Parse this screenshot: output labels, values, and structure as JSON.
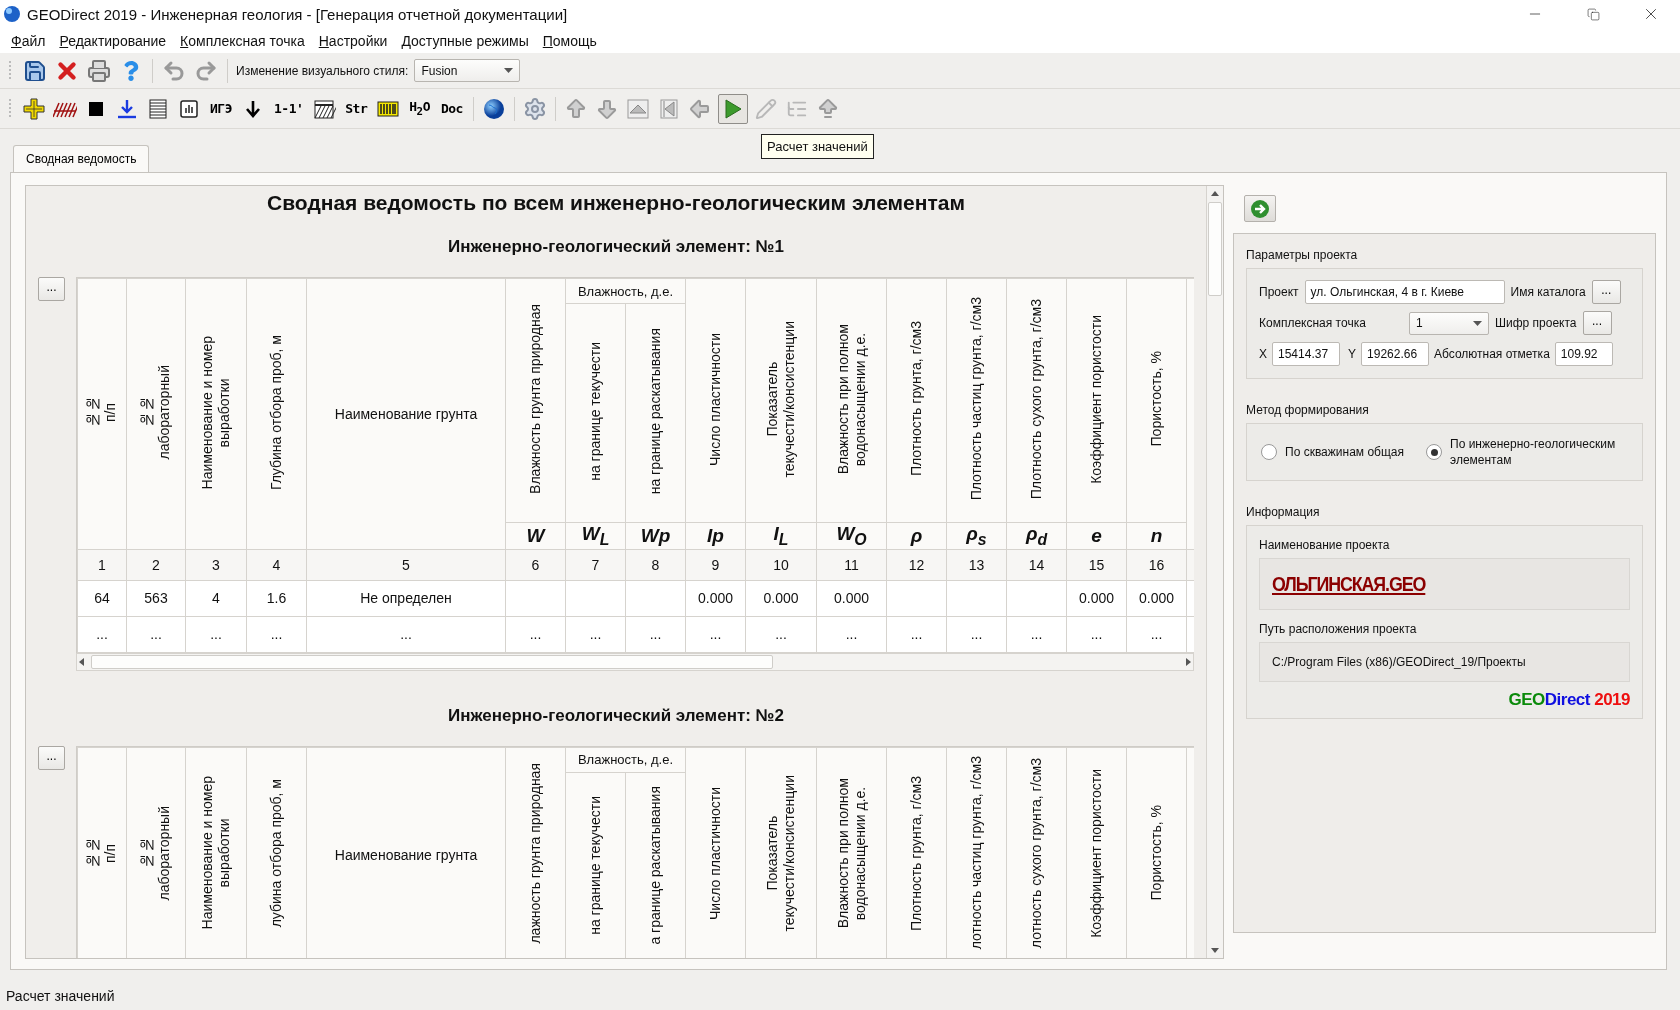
{
  "window": {
    "title": "GEODirect 2019 - Инженерная геология - [Генерация отчетной документации]"
  },
  "menu": [
    "Файл",
    "Редактирование",
    "Комплексная точка",
    "Настройки",
    "Доступные режимы",
    "Помощь"
  ],
  "style_combo": {
    "label": "Изменение визуального стиля:",
    "value": "Fusion"
  },
  "toolbar_text_buttons": [
    "ИГЭ",
    "1-1'",
    "Str",
    "H$_{2}$O",
    "Doc"
  ],
  "run_button": {
    "hovered": true
  },
  "tooltip": "Расчет значений",
  "tabs": [
    {
      "label": "Сводная ведомость",
      "selected": true
    }
  ],
  "report": {
    "title": "Сводная ведомость по всем инженерно-геологическим элементам",
    "sections": [
      {
        "heading": "Инженерно-геологический элемент:  №1",
        "more_button": "...",
        "column_group": "Влажность, д.е.",
        "columns": [
          {
            "kind": "vertical",
            "label": "№№\nп/п"
          },
          {
            "kind": "vertical",
            "label": "№№\nлабораторный"
          },
          {
            "kind": "vertical",
            "label": "Наименование и номер\nвыработки"
          },
          {
            "kind": "vertical",
            "label": "Глубина отбора проб, м"
          },
          {
            "kind": "horizontal",
            "label": "Наименование грунта"
          },
          {
            "kind": "vertical",
            "label": "Влажность грунта природная",
            "symbol": "W"
          },
          {
            "kind": "vertical",
            "in_group": true,
            "label": "на границе текучести",
            "symbol": "W$_{L}$"
          },
          {
            "kind": "vertical",
            "in_group": true,
            "label": "на границе раскатывания",
            "symbol": "Wp"
          },
          {
            "kind": "vertical",
            "label": "Число пластичности",
            "symbol": "Ip"
          },
          {
            "kind": "vertical",
            "label": "Показатель\nтекучести/консистенции",
            "symbol": "I$_{L}$"
          },
          {
            "kind": "vertical",
            "label": "Влажность при полном\nводонасыщении д.е.",
            "symbol": "W$_{O}$"
          },
          {
            "kind": "vertical",
            "label": "Плотность грунта, г/см3",
            "symbol": "ρ"
          },
          {
            "kind": "vertical",
            "label": "Плотность частиц грунта, г/см3",
            "symbol": "ρ$_{s}$"
          },
          {
            "kind": "vertical",
            "label": "Плотность сухого грунта, г/см3",
            "symbol": "ρ$_{d}$"
          },
          {
            "kind": "vertical",
            "label": "Коэффициент пористости",
            "symbol": "e"
          },
          {
            "kind": "vertical",
            "label": "Пористость, %",
            "symbol": "n"
          }
        ],
        "numbers": [
          "1",
          "2",
          "3",
          "4",
          "5",
          "6",
          "7",
          "8",
          "9",
          "10",
          "11",
          "12",
          "13",
          "14",
          "15",
          "16"
        ],
        "rows": [
          [
            "64",
            "563",
            "4",
            "1.6",
            "Не определен",
            null,
            null,
            null,
            "0.000",
            "0.000",
            "0.000",
            null,
            null,
            null,
            "0.000",
            "0.000"
          ],
          [
            "...",
            "...",
            "...",
            "...",
            "...",
            "...",
            "...",
            "...",
            "...",
            "...",
            "...",
            "...",
            "...",
            "...",
            "...",
            "..."
          ]
        ]
      },
      {
        "heading": "Инженерно-геологический элемент:  №2",
        "more_button": "...",
        "column_group": "Влажность, д.е.",
        "columns": [
          {
            "kind": "vertical",
            "label": "№№\nп/п"
          },
          {
            "kind": "vertical",
            "label": "№№\nлабораторный"
          },
          {
            "kind": "vertical",
            "label": "Наименование и номер\nвыработки"
          },
          {
            "kind": "vertical",
            "label": "лубина отбора проб, м"
          },
          {
            "kind": "horizontal",
            "label": "Наименование грунта"
          },
          {
            "kind": "vertical",
            "label": "лажность грунта природная"
          },
          {
            "kind": "vertical",
            "in_group": true,
            "label": "на границе текучести"
          },
          {
            "kind": "vertical",
            "in_group": true,
            "label": "а границе раскатывания"
          },
          {
            "kind": "vertical",
            "label": "Число пластичности"
          },
          {
            "kind": "vertical",
            "label": "Показатель\nтекучести/консистенции"
          },
          {
            "kind": "vertical",
            "label": "Влажность при полном\nводонасыщении д.е."
          },
          {
            "kind": "vertical",
            "label": "Плотность грунта, г/см3"
          },
          {
            "kind": "vertical",
            "label": "лотность частиц грунта, г/см3"
          },
          {
            "kind": "vertical",
            "label": "лотность сухого грунта, г/см3"
          },
          {
            "kind": "vertical",
            "label": "Коэффициент пористости"
          },
          {
            "kind": "vertical",
            "label": "Пористость, %"
          }
        ]
      }
    ]
  },
  "project_params": {
    "title": "Параметры проекта",
    "project_label": "Проект",
    "project_value": "ул. Ольгинская, 4 в г. Киеве",
    "catalog_label": "Имя каталога",
    "catalog_button": "...",
    "point_label": "Комплексная точка",
    "point_value": "1",
    "cipher_label": "Шифр проекта",
    "cipher_button": "...",
    "x_label": "X",
    "x_value": "15414.37",
    "y_label": "Y",
    "y_value": "19262.66",
    "elev_label": "Абсолютная отметка",
    "elev_value": "109.92"
  },
  "method": {
    "title": "Метод формирования",
    "options": [
      {
        "label": "По скважинам общая",
        "selected": false
      },
      {
        "label": "По инженерно-геологическим элементам",
        "selected": true
      }
    ]
  },
  "info": {
    "title": "Информация",
    "name_label": "Наименование проекта",
    "name_value": "ОЛЬГИНСКАЯ.GEO",
    "path_label": "Путь расположения проекта",
    "path_value": "C:/Program Files (x86)/GEODirect_19/Проекты",
    "logo": [
      {
        "text": "GEO",
        "color": "#0a8a0a"
      },
      {
        "text": "Direct",
        "color": "#1010e0"
      },
      {
        "text": " 2019",
        "color": "#ee1010"
      }
    ]
  },
  "status_bar": "Расчет значений"
}
